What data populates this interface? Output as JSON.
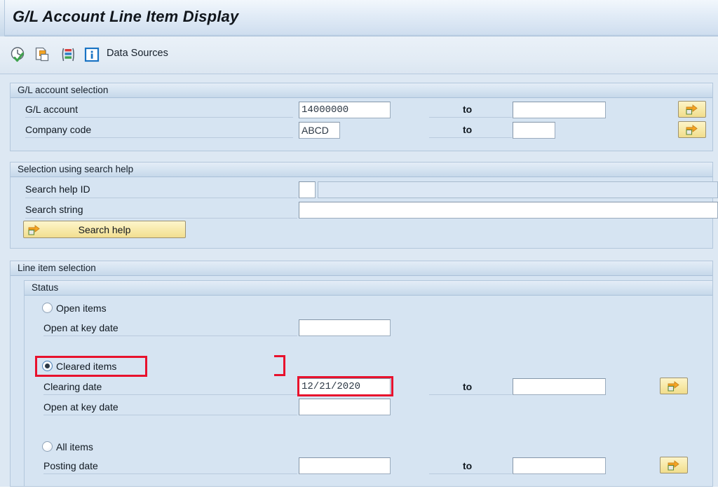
{
  "window": {
    "title": "G/L Account Line Item Display"
  },
  "toolbar": {
    "icons": [
      {
        "name": "execute-clock-check-icon",
        "label": "Execute"
      },
      {
        "name": "copy-documents-icon",
        "label": "Get Variant"
      },
      {
        "name": "variant-list-icon",
        "label": "Display Variant"
      },
      {
        "name": "information-icon",
        "label": "Information"
      }
    ],
    "data_sources_label": "Data Sources"
  },
  "sections": {
    "gl_account_selection": {
      "title": "G/L account selection",
      "rows": [
        {
          "label": "G/L account",
          "value": "14000000",
          "to_label": "to",
          "to_value": "",
          "has_multi_select": true
        },
        {
          "label": "Company code",
          "value": "ABCD",
          "to_label": "to",
          "to_value": "",
          "has_multi_select": true
        }
      ]
    },
    "search_help": {
      "title": "Selection using search help",
      "rows": [
        {
          "label": "Search help ID",
          "value": "",
          "description_value": ""
        },
        {
          "label": "Search string",
          "value": ""
        }
      ],
      "button_label": "Search help"
    },
    "line_item_selection": {
      "title": "Line item selection",
      "status": {
        "title": "Status",
        "options": [
          {
            "radio_label": "Open items",
            "selected": false,
            "fields": [
              {
                "label": "Open at key date",
                "value": "",
                "to_label": "",
                "to_value": "",
                "has_multi_select": false
              }
            ]
          },
          {
            "radio_label": "Cleared items",
            "selected": true,
            "fields": [
              {
                "label": "Clearing date",
                "value": "12/21/2020",
                "to_label": "to",
                "to_value": "",
                "has_multi_select": true
              },
              {
                "label": "Open at key date",
                "value": "",
                "to_label": "",
                "to_value": "",
                "has_multi_select": false
              }
            ]
          },
          {
            "radio_label": "All items",
            "selected": false,
            "fields": [
              {
                "label": "Posting date",
                "value": "",
                "to_label": "to",
                "to_value": "",
                "has_multi_select": true
              }
            ]
          }
        ]
      }
    }
  },
  "annotations": {
    "highlight_color": "#e8112d",
    "targets": [
      "cleared-items-radio",
      "clearing-date-field"
    ]
  },
  "colors": {
    "panel_background": "#d6e4f2",
    "header_gradient_top": "#e4edf7",
    "header_gradient_bottom": "#c6d8ea",
    "button_yellow": "#f7e9a8",
    "annotation_red": "#e8112d"
  }
}
